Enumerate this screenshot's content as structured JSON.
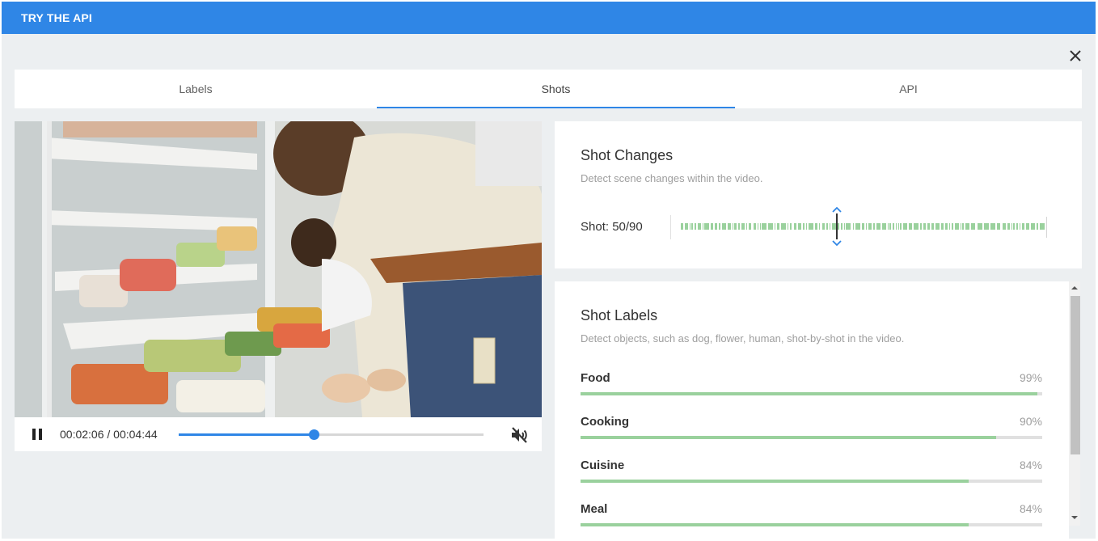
{
  "header": {
    "title": "TRY THE API"
  },
  "tabs": [
    {
      "label": "Labels",
      "active": false
    },
    {
      "label": "Shots",
      "active": true
    },
    {
      "label": "API",
      "active": false
    }
  ],
  "player": {
    "time_current": "00:02:06",
    "time_separator": " / ",
    "time_total": "00:04:44",
    "progress_fraction": 0.444,
    "muted": true
  },
  "shot_changes": {
    "title": "Shot Changes",
    "description": "Detect scene changes within the video.",
    "shot_label": "Shot: 50/90",
    "current_shot": 50,
    "total_shots": 90
  },
  "shot_labels": {
    "title": "Shot Labels",
    "description": "Detect objects, such as dog, flower, human, shot-by-shot in the video.",
    "items": [
      {
        "name": "Food",
        "percent": "99%",
        "value": 0.99
      },
      {
        "name": "Cooking",
        "percent": "90%",
        "value": 0.9
      },
      {
        "name": "Cuisine",
        "percent": "84%",
        "value": 0.84
      },
      {
        "name": "Meal",
        "percent": "84%",
        "value": 0.84
      }
    ]
  },
  "colors": {
    "accent": "#2f86e6",
    "bar_green": "#9ad19d",
    "background": "#eceff1"
  },
  "icons": {
    "close": "close-icon",
    "pause": "pause-icon",
    "mute": "volume-off-icon",
    "shot_marker": "shot-marker-icon"
  }
}
